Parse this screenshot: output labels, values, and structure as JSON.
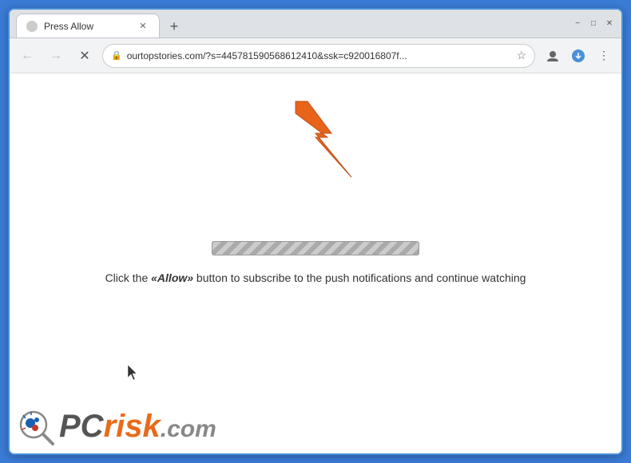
{
  "window": {
    "title": "Press Allow",
    "new_tab_symbol": "+",
    "minimize": "−",
    "maximize": "□",
    "close": "✕"
  },
  "toolbar": {
    "back_label": "←",
    "forward_label": "→",
    "close_label": "✕",
    "url": "ourtopstories.com/?s=445781590568612410&ssk=c920016807f...",
    "lock_symbol": "🔒",
    "star_symbol": "☆",
    "profile_symbol": "⊙",
    "menu_symbol": "⋮",
    "download_symbol": "⊕"
  },
  "page": {
    "instructions": "Click the «Allow» button to subscribe to the push notifications and continue watching",
    "allow_word": "«Allow»"
  },
  "pcrisk": {
    "pc": "PC",
    "risk": "risk",
    "dotcom": ".com"
  }
}
